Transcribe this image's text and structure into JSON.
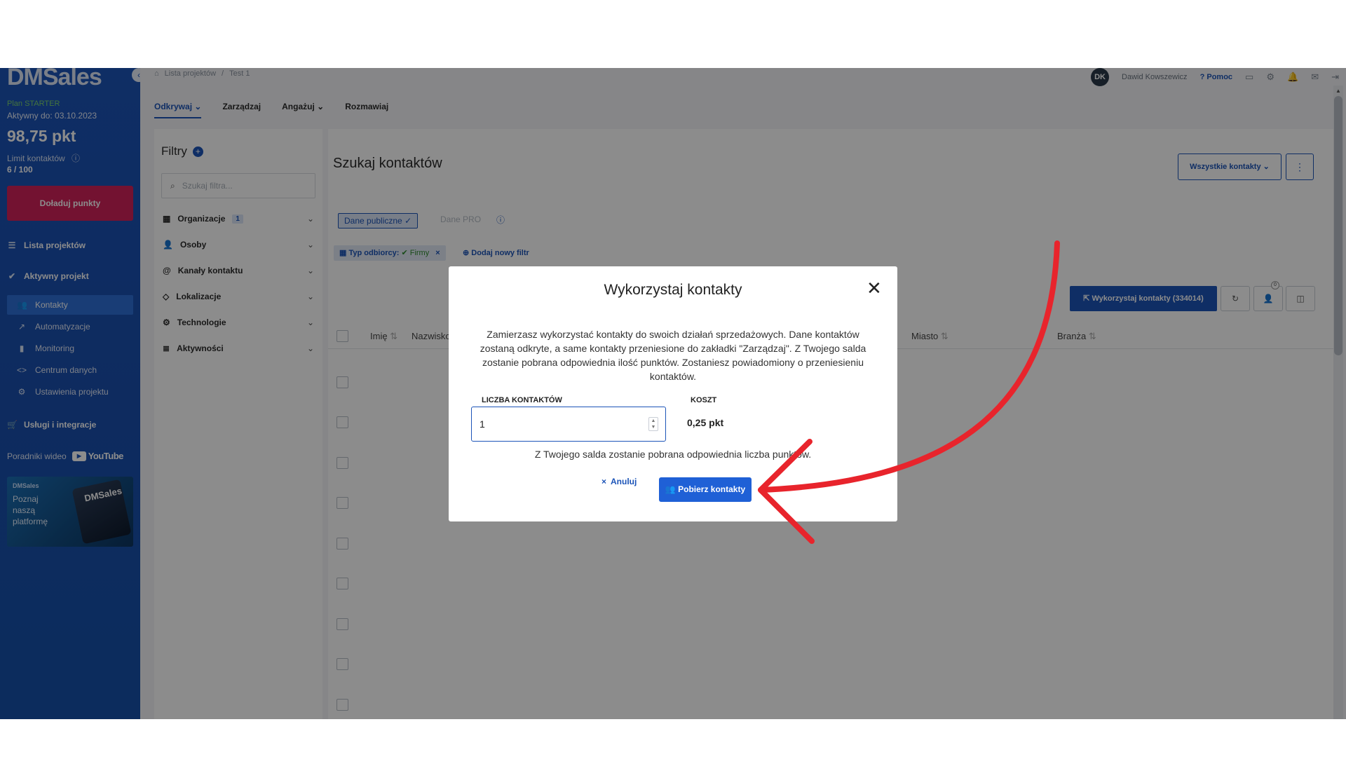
{
  "sidebar": {
    "logo": "DMSales",
    "plan_name": "Plan STARTER",
    "active_until": "Aktywny do: 03.10.2023",
    "points": "98,75 pkt",
    "limit_label": "Limit kontaktów",
    "limit_value": "6 / 100",
    "topup_label": "Doładuj punkty",
    "project_list": "Lista projektów",
    "active_project": "Aktywny projekt",
    "sub_items": [
      "Kontakty",
      "Automatyzacje",
      "Monitoring",
      "Centrum danych",
      "Ustawienia projektu"
    ],
    "services": "Usługi i integracje",
    "video_label": "Poradniki wideo",
    "youtube": "YouTube",
    "promo_brand": "DMSales",
    "promo_text": "Poznaj naszą platformę"
  },
  "topbar": {
    "breadcrumb_root": "Lista projektów",
    "breadcrumb_sep": "/",
    "breadcrumb_current": "Test 1",
    "avatar_initials": "DK",
    "user_name": "Dawid Kowszewicz",
    "help": "Pomoc"
  },
  "tabs": [
    "Odkrywaj",
    "Zarządzaj",
    "Angażuj",
    "Rozmawiaj"
  ],
  "filters": {
    "title": "Filtry",
    "search_placeholder": "Szukaj filtra...",
    "items": [
      "Organizacje",
      "Osoby",
      "Kanały kontaktu",
      "Lokalizacje",
      "Technologie",
      "Aktywności"
    ],
    "org_count": "1"
  },
  "main": {
    "title": "Szukaj kontaktów",
    "all_contacts": "Wszystkie kontakty",
    "public_data": "Dane publiczne",
    "pro_data": "Dane PRO",
    "chip_label": "Typ odbiorcy:",
    "chip_value": "Firmy",
    "add_filter": "Dodaj nowy filtr",
    "use_contacts": "Wykorzystaj kontakty (334014)",
    "badge_count": "0",
    "columns": [
      "Imię",
      "Nazwisko",
      "Miasto",
      "Branża"
    ]
  },
  "modal": {
    "title": "Wykorzystaj kontakty",
    "description": "Zamierzasz wykorzystać kontakty do swoich działań sprzedażowych. Dane kontaktów zostaną odkryte, a same kontakty przeniesione do zakładki \"Zarządzaj\". Z Twojego salda zostanie pobrana odpowiednia ilość punktów. Zostaniesz powiadomiony o przeniesieniu kontaktów.",
    "qty_label": "LICZBA KONTAKTÓW",
    "qty_value": "1",
    "cost_label": "KOSZT",
    "cost_value": "0,25 pkt",
    "note": "Z Twojego salda zostanie pobrana odpowiednia liczba punktów.",
    "cancel": "Anuluj",
    "confirm": "Pobierz kontakty"
  },
  "colors": {
    "brand_blue": "#1c54b8",
    "topup_pink": "#d2225a",
    "annotation_red": "#e8242c"
  }
}
